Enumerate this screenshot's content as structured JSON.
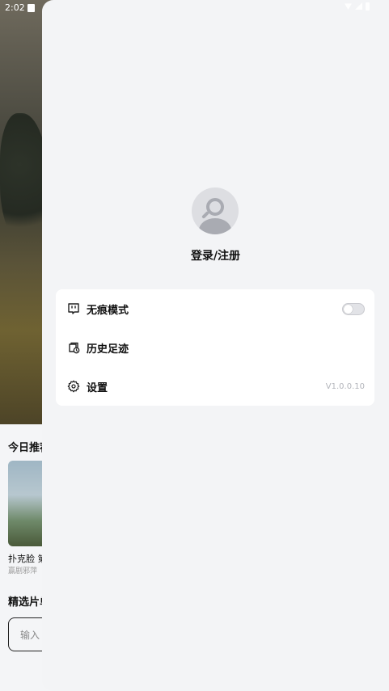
{
  "status_bar": {
    "time": "2:02"
  },
  "background": {
    "section_title": "今日推荐",
    "card_title": "扑克脸 第",
    "card_subtitle": "赢剧邪萍",
    "section_title_2": "精选片单",
    "search_placeholder": "输入"
  },
  "drawer": {
    "login_label": "登录/注册",
    "menu": {
      "incognito_label": "无痕模式",
      "incognito_enabled": false,
      "history_label": "历史足迹",
      "settings_label": "设置",
      "version": "V1.0.0.10"
    }
  }
}
